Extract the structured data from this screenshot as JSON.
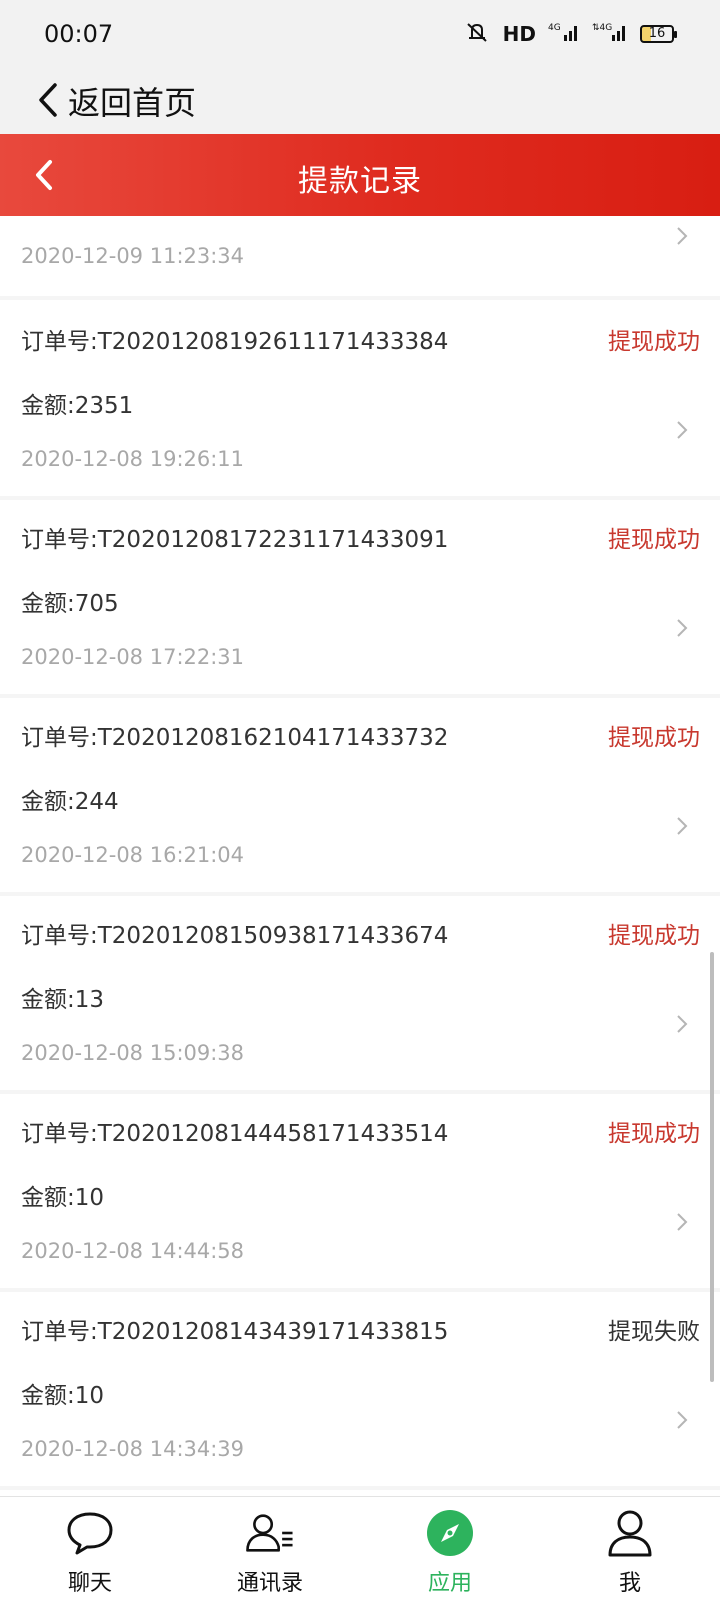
{
  "status_bar": {
    "time": "00:07",
    "hd": "HD",
    "net1": "4G",
    "net2": "4G",
    "battery": "16"
  },
  "nav": {
    "back_label": "返回首页"
  },
  "header": {
    "title": "提款记录",
    "color": "#df2b1f"
  },
  "partial_item": {
    "time": "2020-12-09 11:23:34"
  },
  "records": [
    {
      "order": "订单号:T20201208192611171433384",
      "status": "提现成功",
      "amount": "金额:2351",
      "time": "2020-12-08 19:26:11"
    },
    {
      "order": "订单号:T20201208172231171433091",
      "status": "提现成功",
      "amount": "金额:705",
      "time": "2020-12-08 17:22:31"
    },
    {
      "order": "订单号:T20201208162104171433732",
      "status": "提现成功",
      "amount": "金额:244",
      "time": "2020-12-08 16:21:04"
    },
    {
      "order": "订单号:T20201208150938171433674",
      "status": "提现成功",
      "amount": "金额:13",
      "time": "2020-12-08 15:09:38"
    },
    {
      "order": "订单号:T20201208144458171433514",
      "status": "提现成功",
      "amount": "金额:10",
      "time": "2020-12-08 14:44:58"
    },
    {
      "order": "订单号:T20201208143439171433815",
      "status": "提现失败",
      "amount": "金额:10",
      "time": "2020-12-08 14:34:39"
    }
  ],
  "colors": {
    "success": "#c8382e",
    "fail": "#333333",
    "active_tab": "#2db35d"
  },
  "tabs": [
    {
      "label": "聊天",
      "icon": "chat-icon",
      "active": false
    },
    {
      "label": "通讯录",
      "icon": "contacts-icon",
      "active": false
    },
    {
      "label": "应用",
      "icon": "compass-icon",
      "active": true
    },
    {
      "label": "我",
      "icon": "person-icon",
      "active": false
    }
  ]
}
